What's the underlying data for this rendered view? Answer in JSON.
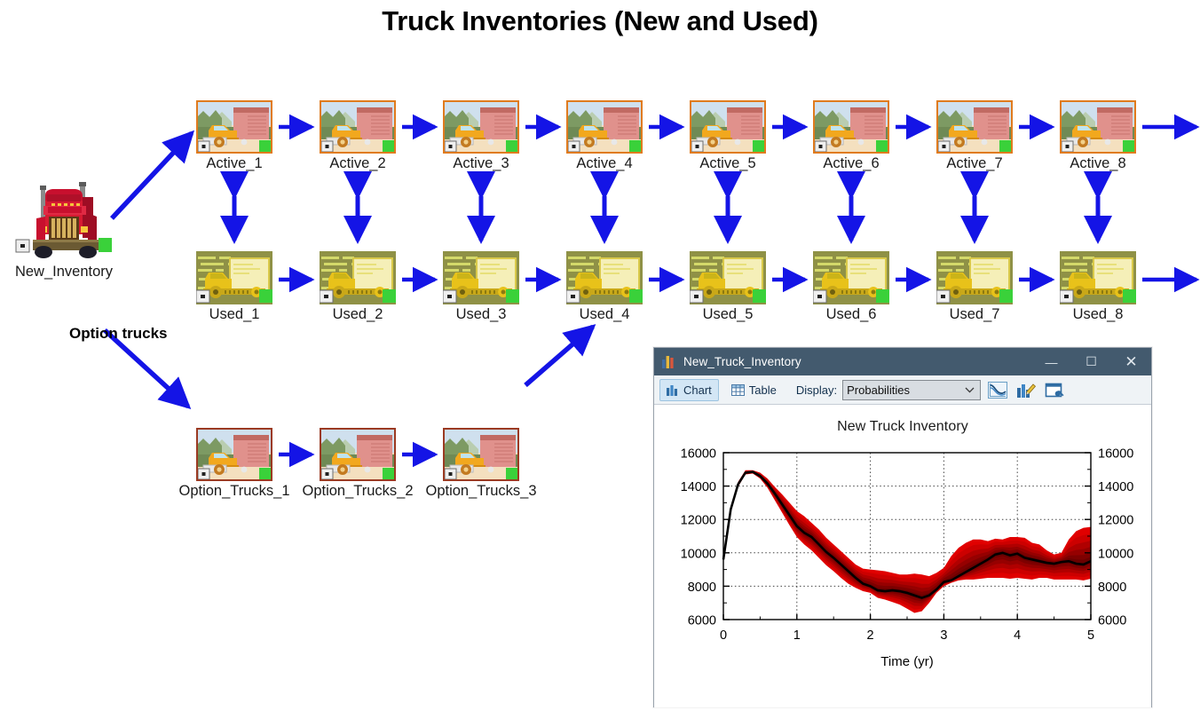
{
  "page": {
    "title": "Truck Inventories (New and Used)",
    "background": "#ffffff",
    "arrow_color": "#1414e6",
    "label_color": "#1a1a1a"
  },
  "diagram": {
    "source_node": {
      "label": "New_Inventory",
      "icon": "semi-truck-icon"
    },
    "branch_label": "Option trucks",
    "active_row": {
      "name": "Active",
      "icon": "red-box-truck-icon",
      "nodes": [
        {
          "label": "Active_1"
        },
        {
          "label": "Active_2"
        },
        {
          "label": "Active_3"
        },
        {
          "label": "Active_4"
        },
        {
          "label": "Active_5"
        },
        {
          "label": "Active_6"
        },
        {
          "label": "Active_7"
        },
        {
          "label": "Active_8"
        }
      ]
    },
    "used_row": {
      "name": "Used",
      "icon": "yellow-box-truck-icon",
      "nodes": [
        {
          "label": "Used_1"
        },
        {
          "label": "Used_2"
        },
        {
          "label": "Used_3"
        },
        {
          "label": "Used_4"
        },
        {
          "label": "Used_5"
        },
        {
          "label": "Used_6"
        },
        {
          "label": "Used_7"
        },
        {
          "label": "Used_8"
        }
      ]
    },
    "option_row": {
      "name": "Option_Trucks",
      "icon": "red-box-truck-icon",
      "nodes": [
        {
          "label": "Option_Trucks_1"
        },
        {
          "label": "Option_Trucks_2"
        },
        {
          "label": "Option_Trucks_3"
        }
      ]
    }
  },
  "window": {
    "title": "New_Truck_Inventory",
    "title_icon": "bar-chart-icon",
    "minimize": "—",
    "maximize": "☐",
    "close": "✕",
    "toolbar": {
      "chart_tab": "Chart",
      "table_tab": "Table",
      "display_label": "Display:",
      "display_value": "Probabilities",
      "display_options": [
        "Probabilities"
      ],
      "icons": [
        "line-chart-icon",
        "bar-chart-edit-icon",
        "window-settings-icon"
      ]
    }
  },
  "chart_data": {
    "type": "area",
    "title": "New Truck Inventory",
    "xlabel": "Time (yr)",
    "ylabel": "",
    "xlim": [
      0,
      5
    ],
    "ylim": [
      6000,
      16000
    ],
    "xticks": [
      0,
      1,
      2,
      3,
      4,
      5
    ],
    "yticks": [
      6000,
      8000,
      10000,
      12000,
      14000,
      16000
    ],
    "yticks_right": [
      6000,
      8000,
      10000,
      12000,
      14000,
      16000
    ],
    "grid": "dotted",
    "legend": "none",
    "band_color": "#c40000",
    "band_inner_color": "#8f0000",
    "line_color": "#000000",
    "x": [
      0.0,
      0.1,
      0.2,
      0.3,
      0.4,
      0.5,
      0.6,
      0.7,
      0.8,
      0.9,
      1.0,
      1.1,
      1.2,
      1.3,
      1.4,
      1.5,
      1.6,
      1.7,
      1.8,
      1.9,
      2.0,
      2.1,
      2.2,
      2.3,
      2.4,
      2.5,
      2.6,
      2.7,
      2.8,
      2.9,
      3.0,
      3.1,
      3.2,
      3.3,
      3.4,
      3.5,
      3.6,
      3.7,
      3.8,
      3.9,
      4.0,
      4.1,
      4.2,
      4.3,
      4.4,
      4.5,
      4.6,
      4.7,
      4.8,
      4.9,
      5.0
    ],
    "series": [
      {
        "name": "median",
        "values": [
          9600,
          12600,
          14100,
          14800,
          14850,
          14600,
          14150,
          13550,
          12900,
          12250,
          11600,
          11200,
          10950,
          10500,
          10050,
          9700,
          9300,
          8900,
          8500,
          8150,
          8000,
          7750,
          7700,
          7750,
          7700,
          7600,
          7450,
          7300,
          7450,
          7800,
          8250,
          8350,
          8600,
          8850,
          9100,
          9350,
          9600,
          9900,
          10000,
          9850,
          9950,
          9700,
          9600,
          9500,
          9400,
          9350,
          9450,
          9500,
          9350,
          9300,
          9500
        ]
      },
      {
        "name": "upper_band",
        "values": [
          9700,
          12700,
          14250,
          14950,
          14950,
          14800,
          14450,
          13950,
          13500,
          13000,
          12500,
          12200,
          11800,
          11400,
          10900,
          10500,
          10100,
          9700,
          9300,
          9050,
          9000,
          8950,
          8900,
          8800,
          8700,
          8700,
          8750,
          8700,
          8600,
          8800,
          9100,
          9800,
          10300,
          10600,
          10800,
          10800,
          10700,
          10850,
          10800,
          10950,
          10950,
          10900,
          10600,
          10500,
          10150,
          9900,
          10000,
          10800,
          11300,
          11500,
          11550
        ]
      },
      {
        "name": "lower_band",
        "values": [
          9550,
          12500,
          13950,
          14700,
          14750,
          14450,
          13900,
          13150,
          12400,
          11650,
          10950,
          10500,
          10150,
          9700,
          9250,
          8900,
          8500,
          8150,
          7900,
          7700,
          7600,
          7300,
          7200,
          7050,
          6900,
          6650,
          6400,
          6500,
          7000,
          7600,
          8000,
          8200,
          8350,
          8400,
          8400,
          8450,
          8500,
          8500,
          8500,
          8450,
          8500,
          8450,
          8400,
          8500,
          8500,
          8400,
          8400,
          8400,
          8400,
          8350,
          8450
        ]
      }
    ]
  }
}
